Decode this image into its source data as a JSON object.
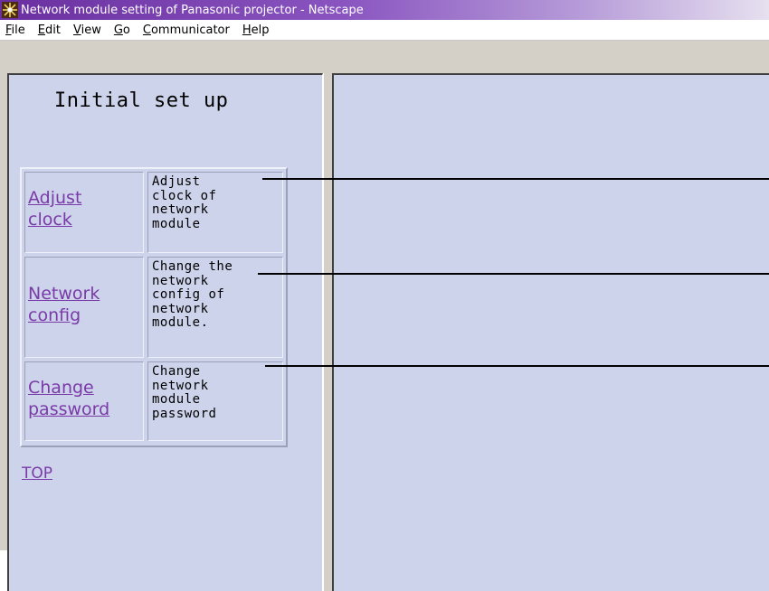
{
  "window": {
    "title": "Network module setting of Panasonic projector - Netscape",
    "icon": "netscape-icon"
  },
  "menubar": {
    "items": [
      {
        "label": "File",
        "mnemonic": "F",
        "rest": "ile"
      },
      {
        "label": "Edit",
        "mnemonic": "E",
        "rest": "dit"
      },
      {
        "label": "View",
        "mnemonic": "V",
        "rest": "iew"
      },
      {
        "label": "Go",
        "mnemonic": "G",
        "rest": "o"
      },
      {
        "label": "Communicator",
        "mnemonic": "C",
        "rest": "ommunicator"
      },
      {
        "label": "Help",
        "mnemonic": "H",
        "rest": "elp"
      }
    ]
  },
  "left_frame": {
    "heading": "Initial set up",
    "options": [
      {
        "link_line1": "Adjust",
        "link_line2": "clock",
        "description": "Adjust\nclock of\nnetwork\nmodule"
      },
      {
        "link_line1": "Network",
        "link_line2": "config",
        "description": "Change the\nnetwork\nconfig of\nnetwork\nmodule."
      },
      {
        "link_line1": "Change",
        "link_line2": "password",
        "description": "Change\nnetwork\nmodule\npassword"
      }
    ],
    "top_link": "TOP"
  },
  "colors": {
    "frame_background": "#cdd3ea",
    "link_color": "#7a3aa8",
    "titlebar_start": "#6a2fa0"
  }
}
